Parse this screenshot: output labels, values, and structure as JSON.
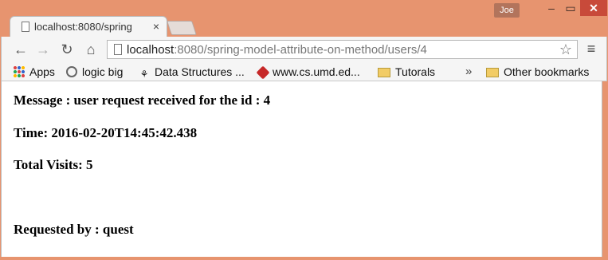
{
  "window": {
    "user_name": "Joe",
    "controls": {
      "min": "‒",
      "max": "▭",
      "close": "✕"
    }
  },
  "tab": {
    "title": "localhost:8080/spring",
    "close": "×"
  },
  "toolbar": {
    "url_host": "localhost",
    "url_rest": ":8080/spring-model-attribute-on-method/users/4",
    "star": "☆",
    "menu": "≡",
    "back": "←",
    "forward": "→",
    "reload": "↻",
    "home": "⌂"
  },
  "bookmarks": [
    {
      "label": "Apps",
      "icon": "apps-icon"
    },
    {
      "label": "logic big",
      "icon": "logic-big-icon"
    },
    {
      "label": "Data Structures ...",
      "icon": "data-structures-icon"
    },
    {
      "label": "www.cs.umd.ed...",
      "icon": "cube-icon"
    },
    {
      "label": "Tutorals",
      "icon": "folder-icon"
    },
    {
      "label": "»",
      "icon": "chevron-more-icon"
    },
    {
      "label": "Other bookmarks",
      "icon": "folder-icon"
    }
  ],
  "content": {
    "message": "Message : user request received for the id : 4",
    "time": "Time: 2016-02-20T14:45:42.438",
    "visits": "Total Visits: 5",
    "requested": "Requested by : quest"
  }
}
